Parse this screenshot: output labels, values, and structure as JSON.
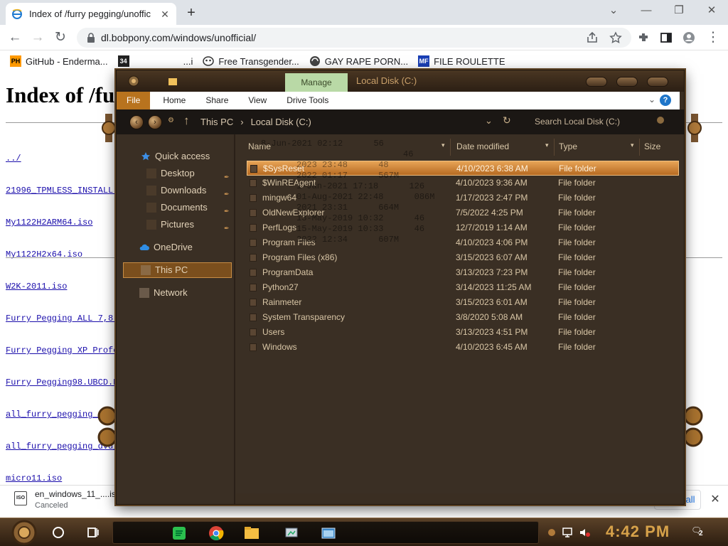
{
  "browser": {
    "tab_title": "Index of /furry pegging/unoffic",
    "tab_close": "✕",
    "new_tab": "+",
    "url": "dl.bobpony.com/windows/unofficial/",
    "bookmarks": [
      {
        "icon": "PH",
        "label": "GitHub - Enderma..."
      },
      {
        "icon": "34",
        "label": "...i"
      },
      {
        "icon": "",
        "label": "Free Transgender..."
      },
      {
        "icon": "",
        "label": "GAY RAPE PORN..."
      },
      {
        "icon": "MF",
        "label": "FILE ROULETTE"
      }
    ]
  },
  "page": {
    "heading": "Index of /furry pegging/unofficial/",
    "links": [
      "../",
      "21996_TPMLESS_INSTALL.iso",
      "My1122H2ARM64.iso",
      "My1122H2x64.iso",
      "W2K-2011.iso",
      "Furry Pegging ALL 7,8.1,10,11 Lite...",
      "Furry Pegging XP Professional SP3...",
      "Furry Pegging98.UBCD.Red.Mix...",
      "all_furry_pegging_dvd_...iso",
      "all_furry_pegging_dvd_...iso",
      "micro11.iso"
    ],
    "ghost_listing": [
      {
        "date": "8-Jun-2021 02:12",
        "size": "56"
      },
      {
        "date": "",
        "size": "46"
      },
      {
        "date": "2023 23:48",
        "size": "48"
      },
      {
        "date": "2022 01:17",
        "size": "567M"
      },
      {
        "date": "1-Jan-2021 17:18",
        "size": "126"
      },
      {
        "date": "01-Aug-2021 22:48",
        "size": "086M"
      },
      {
        "date": "2021 23:31",
        "size": "664M"
      },
      {
        "date": "13-May-2019 10:32",
        "size": "46"
      },
      {
        "date": "15-May-2019 10:33",
        "size": "46"
      },
      {
        "date": "2022 12:34",
        "size": "607M"
      }
    ]
  },
  "download": {
    "filename": "en_windows_11_....iso",
    "status": "Canceled",
    "show_all": "Show all",
    "close": "✕"
  },
  "explorer": {
    "title": "Local Disk (C:)",
    "manage_tab": "Manage",
    "ribbon_tabs": [
      "File",
      "Home",
      "Share",
      "View",
      "Drive Tools"
    ],
    "help": "?",
    "address": [
      "This PC",
      "›",
      "Local Disk (C:)"
    ],
    "search_placeholder": "Search Local Disk (C:)",
    "nav": {
      "quick_access": "Quick access",
      "desktop": "Desktop",
      "downloads": "Downloads",
      "documents": "Documents",
      "pictures": "Pictures",
      "onedrive": "OneDrive",
      "this_pc": "This PC",
      "network": "Network"
    },
    "columns": {
      "name": "Name",
      "date": "Date modified",
      "type": "Type",
      "size": "Size"
    },
    "files": [
      {
        "name": "$SysReset",
        "date": "4/10/2023 6:38 AM",
        "type": "File folder"
      },
      {
        "name": "$WinREAgent",
        "date": "4/10/2023 9:36 AM",
        "type": "File folder"
      },
      {
        "name": "mingw64",
        "date": "1/17/2023 2:47 PM",
        "type": "File folder"
      },
      {
        "name": "OldNewExplorer",
        "date": "7/5/2022 4:25 PM",
        "type": "File folder"
      },
      {
        "name": "PerfLogs",
        "date": "12/7/2019 1:14 AM",
        "type": "File folder"
      },
      {
        "name": "Program Files",
        "date": "4/10/2023 4:06 PM",
        "type": "File folder"
      },
      {
        "name": "Program Files (x86)",
        "date": "3/15/2023 6:07 AM",
        "type": "File folder"
      },
      {
        "name": "ProgramData",
        "date": "3/13/2023 7:23 PM",
        "type": "File folder"
      },
      {
        "name": "Python27",
        "date": "3/14/2023 11:25 AM",
        "type": "File folder"
      },
      {
        "name": "Rainmeter",
        "date": "3/15/2023 6:01 AM",
        "type": "File folder"
      },
      {
        "name": "System Transparency",
        "date": "3/8/2020 5:08 AM",
        "type": "File folder"
      },
      {
        "name": "Users",
        "date": "3/13/2023 4:51 PM",
        "type": "File folder"
      },
      {
        "name": "Windows",
        "date": "4/10/2023 6:45 AM",
        "type": "File folder"
      }
    ],
    "selected_index": 0
  },
  "taskbar": {
    "clock": "4:42 PM",
    "notifications": "2"
  },
  "colors": {
    "explorer_bg": "#3a2f24",
    "accent_orange": "#b8731e",
    "selection": "#c9852f",
    "clock": "#d7a24a"
  }
}
